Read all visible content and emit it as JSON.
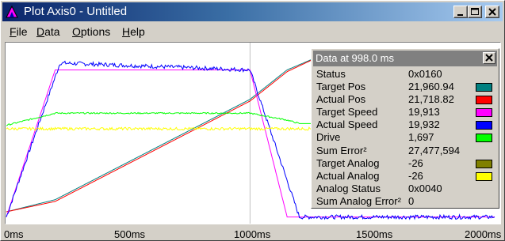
{
  "window": {
    "title": "Plot Axis0 - Untitled"
  },
  "menu": {
    "file": {
      "first": "F",
      "rest": "ile"
    },
    "data": {
      "first": "D",
      "rest": "ata"
    },
    "options": {
      "first": "O",
      "rest": "ptions"
    },
    "help": {
      "first": "H",
      "rest": "elp"
    }
  },
  "panel": {
    "title": "Data at 998.0 ms",
    "rows": [
      {
        "label": "Status",
        "value": "0x0160",
        "color": ""
      },
      {
        "label": "Target Pos",
        "value": "21,960.94",
        "color": "#008080"
      },
      {
        "label": "Actual Pos",
        "value": "21,718.82",
        "color": "#ff0000"
      },
      {
        "label": "Target Speed",
        "value": "19,913",
        "color": "#ff00ff"
      },
      {
        "label": "Actual Speed",
        "value": "19,932",
        "color": "#0000ff"
      },
      {
        "label": "Drive",
        "value": "1,697",
        "color": "#00ff00"
      },
      {
        "label": "Sum Error²",
        "value": "27,477,594",
        "color": ""
      },
      {
        "label": "Target Analog",
        "value": "-26",
        "color": "#808000"
      },
      {
        "label": "Actual Analog",
        "value": "-26",
        "color": "#ffff00"
      },
      {
        "label": "Analog Status",
        "value": "0x0040",
        "color": ""
      },
      {
        "label": "Sum Analog Error²",
        "value": "0",
        "color": ""
      }
    ]
  },
  "xaxis": {
    "ticks": [
      "0ms",
      "500ms",
      "1000ms",
      "1500ms",
      "2000ms"
    ]
  },
  "chart_data": {
    "type": "line",
    "x_unit": "ms",
    "xlim": [
      0,
      2000
    ],
    "cursor_x": 998,
    "series": [
      {
        "name": "Target Pos",
        "color": "#008080",
        "x": [
          0,
          200,
          998,
          1150,
          1300,
          1400
        ],
        "y": [
          0.05,
          0.12,
          0.7,
          0.87,
          0.96,
          0.97
        ]
      },
      {
        "name": "Actual Pos",
        "color": "#ff0000",
        "x": [
          0,
          200,
          998,
          1150,
          1300,
          1400
        ],
        "y": [
          0.05,
          0.11,
          0.69,
          0.86,
          0.96,
          0.97
        ]
      },
      {
        "name": "Target Speed",
        "color": "#ff00ff",
        "x": [
          0,
          200,
          998,
          1150,
          1200
        ],
        "y": [
          0.02,
          0.87,
          0.87,
          0.02,
          0.02
        ]
      },
      {
        "name": "Actual Speed",
        "color": "#0000ff",
        "x": [
          0,
          220,
          998,
          1200,
          2000
        ],
        "y": [
          0.02,
          0.91,
          0.87,
          0.02,
          0.02
        ]
      },
      {
        "name": "Drive",
        "color": "#00ff00",
        "x": [
          0,
          200,
          998,
          1150,
          1200
        ],
        "y": [
          0.55,
          0.62,
          0.62,
          0.58,
          0.56
        ]
      },
      {
        "name": "Actual Analog",
        "color": "#ffff00",
        "x": [
          0,
          2000
        ],
        "y": [
          0.53,
          0.53
        ]
      }
    ]
  }
}
